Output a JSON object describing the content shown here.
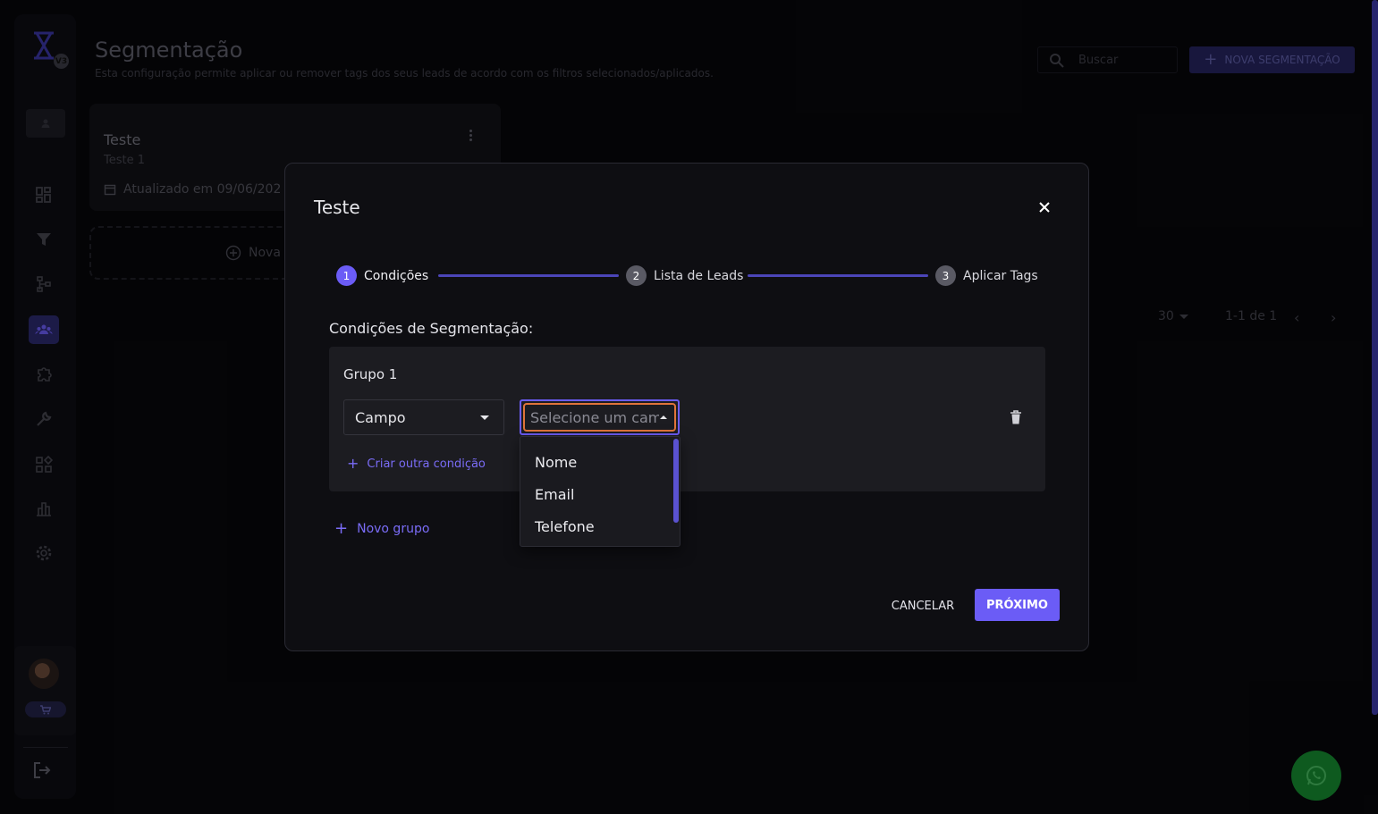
{
  "header": {
    "title": "Segmentação",
    "subtitle": "Esta configuração permite aplicar ou remover tags dos seus leads de acordo com os filtros selecionados/aplicados.",
    "search_placeholder": "Buscar",
    "new_button": "NOVA SEGMENTAÇÃO"
  },
  "sidebar": {
    "logo_badge": "V3",
    "items": [
      "dashboard-icon",
      "filter-icon",
      "hierarchy-icon",
      "segmentation-icon",
      "puzzle-icon",
      "tools-icon",
      "widgets-icon",
      "chart-icon",
      "settings-icon"
    ],
    "active_item": "segmentation-icon"
  },
  "card": {
    "title": "Teste",
    "description": "Teste 1",
    "updated": "Atualizado em 09/06/202",
    "new_label": "Nova s"
  },
  "pagination": {
    "per_page": "30",
    "range": "1-1 de 1"
  },
  "modal": {
    "title": "Teste",
    "steps": [
      {
        "num": "1",
        "label": "Condições"
      },
      {
        "num": "2",
        "label": "Lista de Leads"
      },
      {
        "num": "3",
        "label": "Aplicar Tags"
      }
    ],
    "active_step": 1,
    "conditions_title": "Condições de Segmentação:",
    "group_title": "Grupo 1",
    "field_type": "Campo",
    "field_placeholder": "Selecione um campo",
    "options": [
      "Nome",
      "Email",
      "Telefone"
    ],
    "add_condition": "Criar outra condição",
    "add_group": "Novo grupo",
    "cancel": "CANCELAR",
    "next": "PRÓXIMO"
  },
  "colors": {
    "accent": "#6b5cf6",
    "focus_ring": "#e0743a",
    "whatsapp": "#0e5a1f"
  }
}
